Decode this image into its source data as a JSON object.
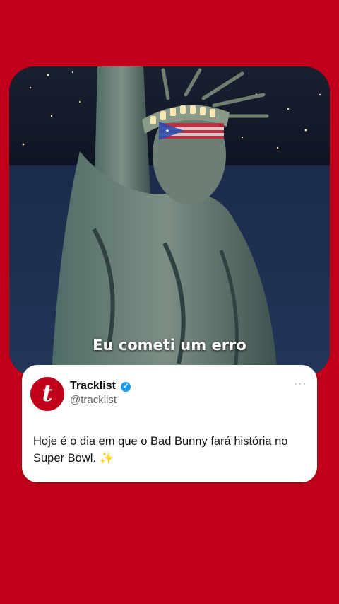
{
  "video": {
    "caption": "Eu cometi um erro"
  },
  "tweet": {
    "avatar_letter": "t",
    "display_name": "Tracklist",
    "verified_icon": "verified-badge-icon",
    "handle": "@tracklist",
    "more_label": "···",
    "text": "Hoje é o dia em que o Bad Bunny fará história no Super Bowl. ✨"
  },
  "colors": {
    "background": "#c0001a",
    "verified": "#1d9bf0"
  }
}
